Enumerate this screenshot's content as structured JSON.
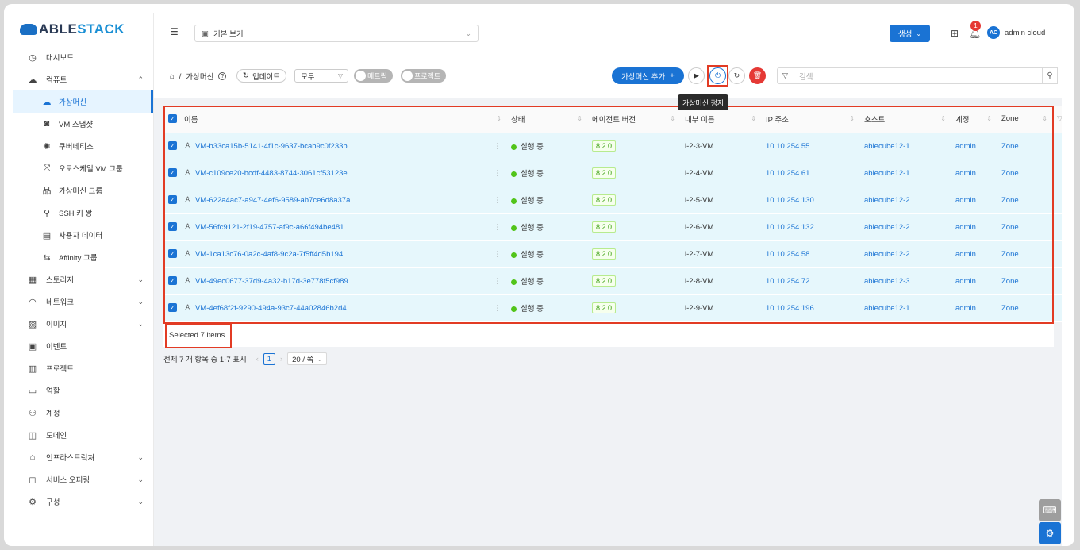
{
  "brand": {
    "part1": "ABLE",
    "part2": "STACK"
  },
  "sidebar": {
    "items": [
      {
        "key": "dashboard",
        "label": "대시보드",
        "icon": "dashboard-icon",
        "glyph": "◷"
      },
      {
        "key": "compute",
        "label": "컴퓨트",
        "icon": "cloud-icon",
        "glyph": "☁",
        "expanded": true
      }
    ],
    "compute_sub": [
      {
        "key": "vm",
        "label": "가상머신",
        "icon": "cloud-server-icon",
        "glyph": "☁",
        "active": true
      },
      {
        "key": "snapshot",
        "label": "VM 스냅샷",
        "icon": "camera-icon",
        "glyph": "◙"
      },
      {
        "key": "k8s",
        "label": "쿠버네티스",
        "icon": "cluster-icon",
        "glyph": "✺"
      },
      {
        "key": "autoscale",
        "label": "오토스케일 VM 그룹",
        "icon": "expand-icon",
        "glyph": "⤧"
      },
      {
        "key": "vmgroup",
        "label": "가상머신 그룹",
        "icon": "hierarchy-icon",
        "glyph": "品"
      },
      {
        "key": "ssh",
        "label": "SSH 키 쌍",
        "icon": "key-icon",
        "glyph": "⚲"
      },
      {
        "key": "userdata",
        "label": "사용자 데이터",
        "icon": "document-icon",
        "glyph": "▤"
      },
      {
        "key": "affinity",
        "label": "Affinity 그룹",
        "icon": "swap-icon",
        "glyph": "⇆"
      }
    ],
    "items2": [
      {
        "key": "storage",
        "label": "스토리지",
        "icon": "database-icon",
        "glyph": "▦",
        "chev": true
      },
      {
        "key": "network",
        "label": "네트워크",
        "icon": "wifi-icon",
        "glyph": "◠",
        "chev": true
      },
      {
        "key": "image",
        "label": "이미지",
        "icon": "picture-icon",
        "glyph": "▨",
        "chev": true
      },
      {
        "key": "event",
        "label": "이벤트",
        "icon": "calendar-icon",
        "glyph": "▣"
      },
      {
        "key": "project",
        "label": "프로젝트",
        "icon": "project-icon",
        "glyph": "▥"
      },
      {
        "key": "role",
        "label": "역할",
        "icon": "id-card-icon",
        "glyph": "▭"
      },
      {
        "key": "account",
        "label": "계정",
        "icon": "team-icon",
        "glyph": "⚇"
      },
      {
        "key": "domain",
        "label": "도메인",
        "icon": "block-icon",
        "glyph": "◫"
      },
      {
        "key": "infra",
        "label": "인프라스트럭쳐",
        "icon": "bank-icon",
        "glyph": "⌂",
        "chev": true
      },
      {
        "key": "offering",
        "label": "서비스 오퍼링",
        "icon": "shopping-icon",
        "glyph": "◻",
        "chev": true
      },
      {
        "key": "config",
        "label": "구성",
        "icon": "settings-icon",
        "glyph": "⚙",
        "chev": true
      }
    ]
  },
  "header": {
    "view_label": "기본 보기",
    "create_label": "생성",
    "notification_count": "1",
    "avatar_initials": "AC",
    "username": "admin cloud"
  },
  "toolbar": {
    "breadcrumb_page": "가상머신",
    "refresh_label": "업데이트",
    "filter_value": "모두",
    "toggle_metrics": "메트릭",
    "toggle_project": "프로젝트",
    "add_vm_label": "가상머신 추가",
    "tooltip_stop": "가상머신 정지",
    "search_placeholder": "검색"
  },
  "table": {
    "columns": [
      "이름",
      "상태",
      "에이전트 버전",
      "내부 이름",
      "IP 주소",
      "호스트",
      "계정",
      "Zone"
    ],
    "rows": [
      {
        "name": "VM-b33ca15b-5141-4f1c-9637-bcab9c0f233b",
        "state": "실행 중",
        "agent": "8.2.0",
        "internal": "i-2-3-VM",
        "ip": "10.10.254.55",
        "host": "ablecube12-1",
        "account": "admin",
        "zone": "Zone"
      },
      {
        "name": "VM-c109ce20-bcdf-4483-8744-3061cf53123e",
        "state": "실행 중",
        "agent": "8.2.0",
        "internal": "i-2-4-VM",
        "ip": "10.10.254.61",
        "host": "ablecube12-1",
        "account": "admin",
        "zone": "Zone"
      },
      {
        "name": "VM-622a4ac7-a947-4ef6-9589-ab7ce6d8a37a",
        "state": "실행 중",
        "agent": "8.2.0",
        "internal": "i-2-5-VM",
        "ip": "10.10.254.130",
        "host": "ablecube12-2",
        "account": "admin",
        "zone": "Zone"
      },
      {
        "name": "VM-56fc9121-2f19-4757-af9c-a66f494be481",
        "state": "실행 중",
        "agent": "8.2.0",
        "internal": "i-2-6-VM",
        "ip": "10.10.254.132",
        "host": "ablecube12-2",
        "account": "admin",
        "zone": "Zone"
      },
      {
        "name": "VM-1ca13c76-0a2c-4af8-9c2a-7f5ff4d5b194",
        "state": "실행 중",
        "agent": "8.2.0",
        "internal": "i-2-7-VM",
        "ip": "10.10.254.58",
        "host": "ablecube12-2",
        "account": "admin",
        "zone": "Zone"
      },
      {
        "name": "VM-49ec0677-37d9-4a32-b17d-3e778f5cf989",
        "state": "실행 중",
        "agent": "8.2.0",
        "internal": "i-2-8-VM",
        "ip": "10.10.254.72",
        "host": "ablecube12-3",
        "account": "admin",
        "zone": "Zone"
      },
      {
        "name": "VM-4ef68f2f-9290-494a-93c7-44a02846b2d4",
        "state": "실행 중",
        "agent": "8.2.0",
        "internal": "i-2-9-VM",
        "ip": "10.10.254.196",
        "host": "ablecube12-1",
        "account": "admin",
        "zone": "Zone"
      }
    ]
  },
  "footer": {
    "selected_text": "Selected 7 items",
    "pagination_summary": "전체 7 개 항목 중 1-7 표시",
    "current_page": "1",
    "page_size": "20 / 쪽"
  }
}
